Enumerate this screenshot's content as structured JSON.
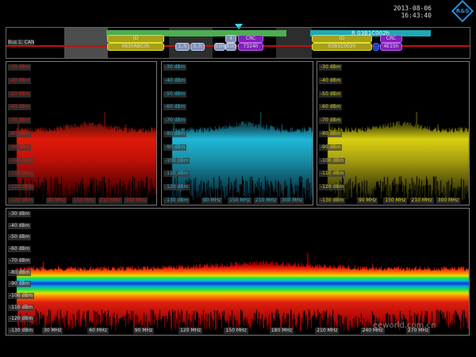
{
  "header": {
    "date": "2013-08-06",
    "time": "16:43:40",
    "logo": "R&S"
  },
  "decode": {
    "bus_label": "Bus 1: CAN",
    "frame1": {
      "id_label": "ID",
      "id_value": "0630ABC0h",
      "crc_label": "CRC",
      "crc_value": "7324h",
      "data": [
        "1..h",
        "3..h",
        "51h",
        "81h"
      ],
      "data_labels": [
        "3",
        "4"
      ]
    },
    "frame2": {
      "title": "R 03B1C002h",
      "id_label": "ID",
      "id_value": "03B1C002h",
      "crc_label": "CRC",
      "crc_value": "4E15h"
    },
    "colors": {
      "frame1": "#4caf50",
      "frame2": "#20a8b8",
      "id": "#c8c020",
      "crc": "#9020c0",
      "bus": "#c01010"
    }
  },
  "panels": [
    {
      "color": "#e01a0a",
      "y_labels": [
        "-30 dBm",
        "-40 dBm",
        "-50 dBm",
        "-60 dBm",
        "-70 dBm",
        "-80 dBm",
        "-90 dBm",
        "-100 dBm",
        "-110 dBm",
        "-120 dBm",
        "-130 dBm"
      ],
      "x_labels": [
        "90 MHz",
        "150 MHz",
        "210 MHz",
        "300 MHz"
      ]
    },
    {
      "color": "#20b8d8",
      "y_labels": [
        "-30 dBm",
        "-40 dBm",
        "-50 dBm",
        "-60 dBm",
        "-70 dBm",
        "-80 dBm",
        "-90 dBm",
        "-100 dBm",
        "-110 dBm",
        "-120 dBm",
        "-130 dBm"
      ],
      "x_labels": [
        "90 MHz",
        "150 MHz",
        "210 MHz",
        "300 MHz"
      ]
    },
    {
      "color": "#d8d010",
      "y_labels": [
        "-30 dBm",
        "-40 dBm",
        "-50 dBm",
        "-60 dBm",
        "-70 dBm",
        "-80 dBm",
        "-90 dBm",
        "-100 dBm",
        "-110 dBm",
        "-120 dBm",
        "-130 dBm"
      ],
      "x_labels": [
        "90 MHz",
        "150 MHz",
        "210 MHz",
        "300 MHz"
      ]
    }
  ],
  "main_spectrum": {
    "y_labels": [
      "-30 dBm",
      "-40 dBm",
      "-50 dBm",
      "-60 dBm",
      "-70 dBm",
      "-80 dBm",
      "-90 dBm",
      "-100 dBm",
      "-110 dBm",
      "-120 dBm",
      "-130 dBm"
    ],
    "x_labels": [
      "30 MHz",
      "60 MHz",
      "90 MHz",
      "120 MHz",
      "150 MHz",
      "180 MHz",
      "210 MHz",
      "240 MHz",
      "270 MHz"
    ],
    "color_map": "rainbow persistence"
  },
  "watermark": "eeworld.com.cn"
}
